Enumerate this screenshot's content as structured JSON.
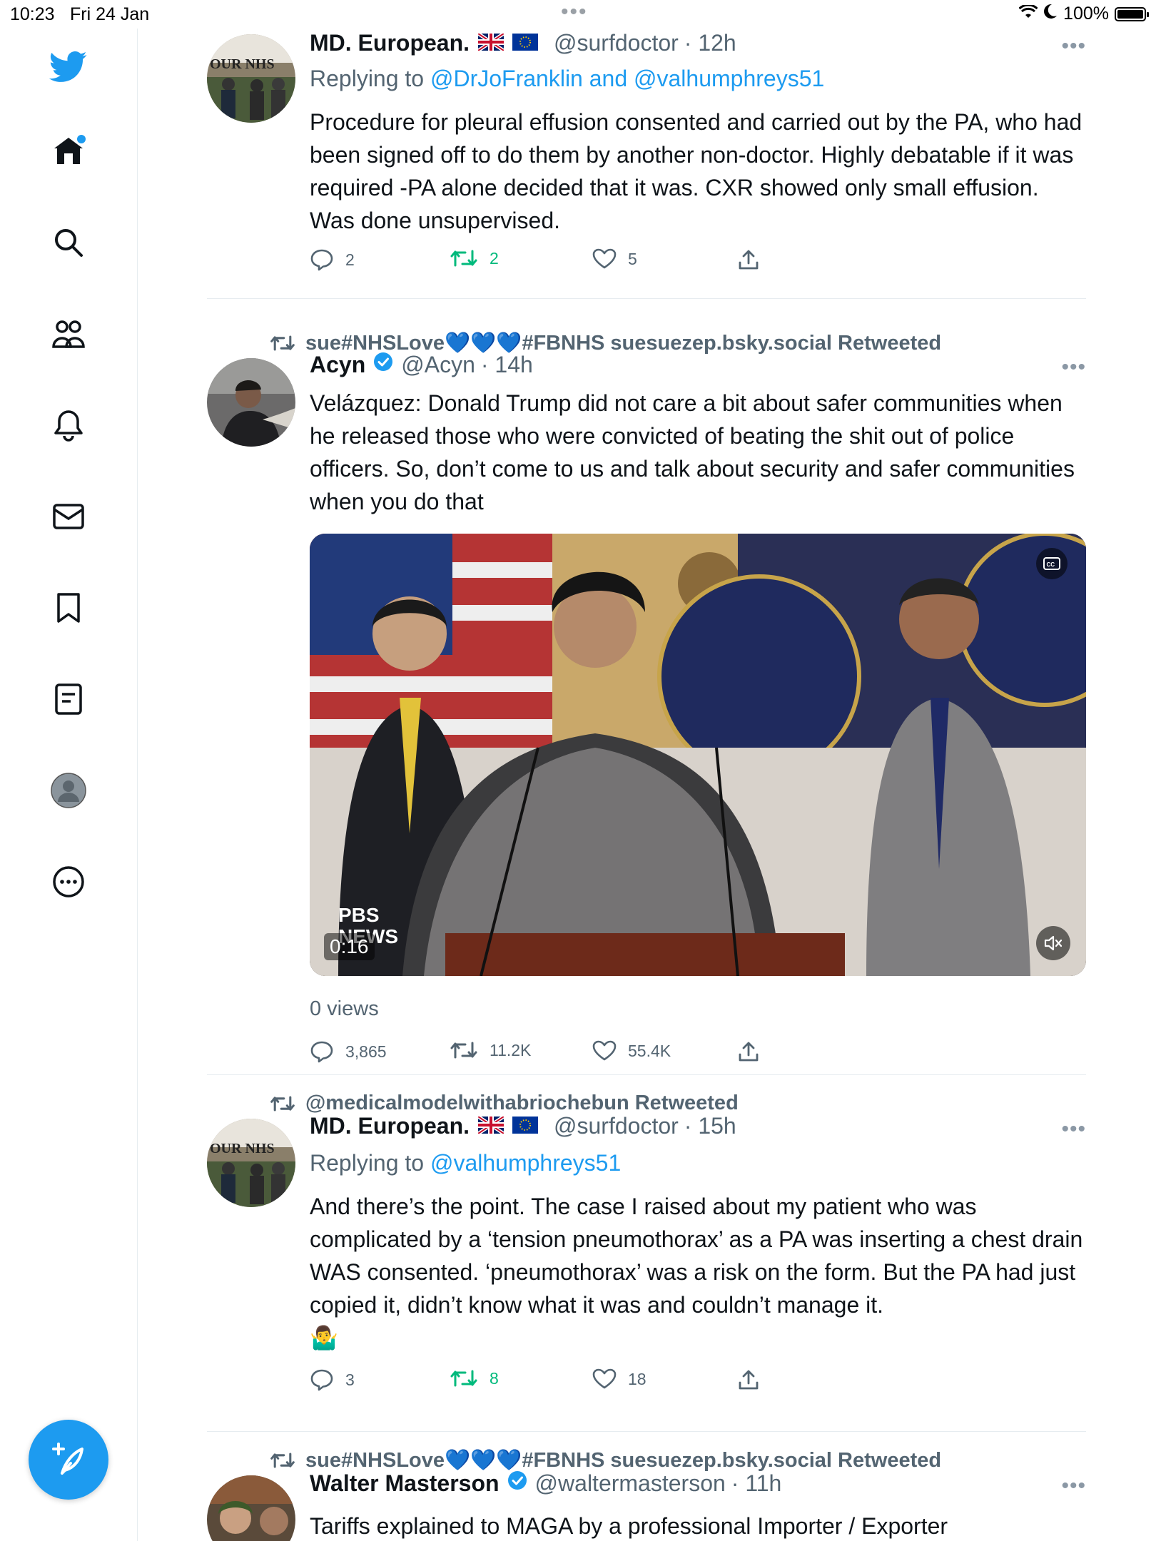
{
  "status_bar": {
    "time": "10:23",
    "date": "Fri 24 Jan",
    "battery": "100%",
    "battery_level": 1.0
  },
  "sidebar": {
    "items": [
      "twitter-logo",
      "home",
      "search",
      "communities",
      "notifications",
      "messages",
      "bookmarks",
      "lists",
      "profile",
      "more"
    ]
  },
  "tweets": [
    {
      "retweeted_by": "",
      "name": "MD. European.",
      "flags": [
        "🇬🇧",
        "🇪🇺"
      ],
      "handle": "@surfdoctor",
      "time": "· 12h",
      "replying_prefix": "Replying to ",
      "replying_to": "@DrJoFranklin and @valhumphreys51",
      "text": "Procedure for pleural effusion consented and carried out by the PA, who had been signed off to do them by another non-doctor. Highly debatable if it was required -PA alone decided that it was. CXR showed only small effusion. Was done unsupervised.",
      "replies": "2",
      "retweets": "2",
      "likes": "5"
    },
    {
      "retweeted_by": "sue#NHSLove💙💙💙#FBNHS suesuezep.bsky.social Retweeted",
      "name": "Acyn",
      "handle": "@Acyn",
      "time": "· 14h",
      "text": "Velázquez: Donald Trump did not care a bit about safer communities when he released those who were convicted of beating the shit out of police officers. So, don’t come to us and talk about security and safer communities when you do that",
      "video": {
        "duration": "0:16",
        "logo_line1": "PBS",
        "logo_line2": "NEWS"
      },
      "views": "0 views",
      "replies": "3,865",
      "retweets": "11.2K",
      "likes": "55.4K"
    },
    {
      "retweeted_by": "@medicalmodelwithabriochebun Retweeted",
      "name": "MD. European.",
      "flags": [
        "🇬🇧",
        "🇪🇺"
      ],
      "handle": "@surfdoctor",
      "time": "· 15h",
      "replying_prefix": "Replying to ",
      "replying_to": "@valhumphreys51",
      "text": "And there’s the point. The case I raised about my patient who was complicated by a ‘tension pneumothorax’ as a PA was inserting a chest drain WAS consented. ‘pneumothorax’ was a risk on the form. But the PA had just copied it, didn’t know what it was and couldn’t manage it.",
      "emoji": "🤷‍♂️",
      "replies": "3",
      "retweets": "8",
      "likes": "18"
    },
    {
      "retweeted_by": "sue#NHSLove💙💙💙#FBNHS suesuezep.bsky.social Retweeted",
      "name": "Walter Masterson",
      "handle": "@waltermasterson",
      "time": "· 11h",
      "text": "Tariffs explained to MAGA by a professional Importer / Exporter"
    }
  ],
  "colors": {
    "accent": "#1d9bf0",
    "retweet_green": "#00ba7c",
    "secondary_text": "#536471"
  }
}
